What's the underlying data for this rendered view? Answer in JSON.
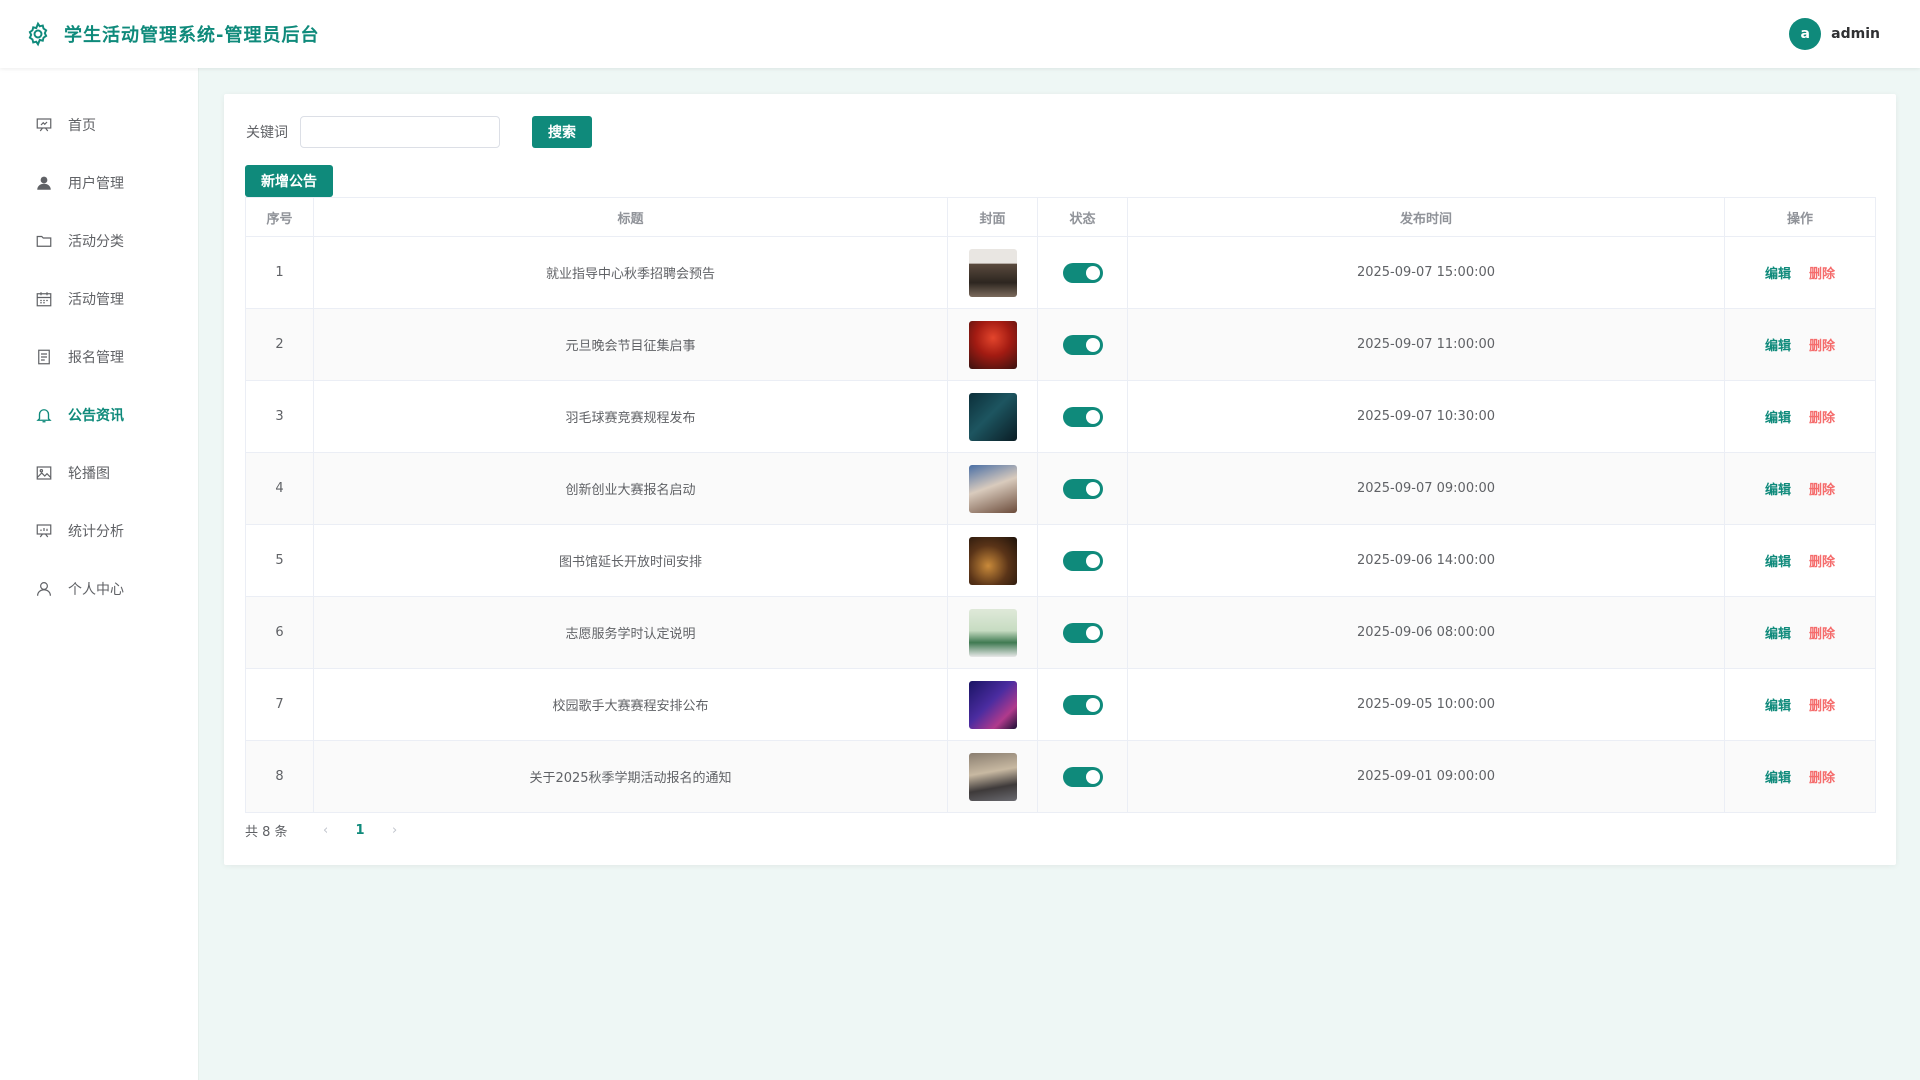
{
  "header": {
    "title": "学生活动管理系统-管理员后台",
    "logo_icon": "gear-icon",
    "user_avatar_letter": "a",
    "user_name": "admin"
  },
  "sidebar": {
    "items": [
      {
        "label": "首页",
        "icon": "presentation-board-icon",
        "active": false
      },
      {
        "label": "用户管理",
        "icon": "user-filled-icon",
        "active": false
      },
      {
        "label": "活动分类",
        "icon": "folder-icon",
        "active": false
      },
      {
        "label": "活动管理",
        "icon": "calendar-icon",
        "active": false
      },
      {
        "label": "报名管理",
        "icon": "document-icon",
        "active": false
      },
      {
        "label": "公告资讯",
        "icon": "bell-icon",
        "active": true
      },
      {
        "label": "轮播图",
        "icon": "picture-icon",
        "active": false
      },
      {
        "label": "统计分析",
        "icon": "data-board-icon",
        "active": false
      },
      {
        "label": "个人中心",
        "icon": "user-icon",
        "active": false
      }
    ]
  },
  "search": {
    "label": "关键词",
    "value": "",
    "placeholder": "",
    "button_label": "搜索"
  },
  "add_button_label": "新增公告",
  "table": {
    "columns": [
      "序号",
      "标题",
      "封面",
      "状态",
      "发布时间",
      "操作"
    ],
    "edit_label": "编辑",
    "delete_label": "删除",
    "rows": [
      {
        "index": "1",
        "title": "就业指导中心秋季招聘会预告",
        "status_on": true,
        "time": "2025-09-07 15:00:00"
      },
      {
        "index": "2",
        "title": "元旦晚会节目征集启事",
        "status_on": true,
        "time": "2025-09-07 11:00:00"
      },
      {
        "index": "3",
        "title": "羽毛球赛竞赛规程发布",
        "status_on": true,
        "time": "2025-09-07 10:30:00"
      },
      {
        "index": "4",
        "title": "创新创业大赛报名启动",
        "status_on": true,
        "time": "2025-09-07 09:00:00"
      },
      {
        "index": "5",
        "title": "图书馆延长开放时间安排",
        "status_on": true,
        "time": "2025-09-06 14:00:00"
      },
      {
        "index": "6",
        "title": "志愿服务学时认定说明",
        "status_on": true,
        "time": "2025-09-06 08:00:00"
      },
      {
        "index": "7",
        "title": "校园歌手大赛赛程安排公布",
        "status_on": true,
        "time": "2025-09-05 10:00:00"
      },
      {
        "index": "8",
        "title": "关于2025秋季学期活动报名的通知",
        "status_on": true,
        "time": "2025-09-01 09:00:00"
      }
    ]
  },
  "pagination": {
    "total_text": "共 8 条",
    "current_page": "1",
    "prev_icon": "chevron-left-icon",
    "next_icon": "chevron-right-icon"
  },
  "colors": {
    "accent": "#0f8a7b",
    "danger": "#f56c6c",
    "background": "#eef7f5"
  }
}
